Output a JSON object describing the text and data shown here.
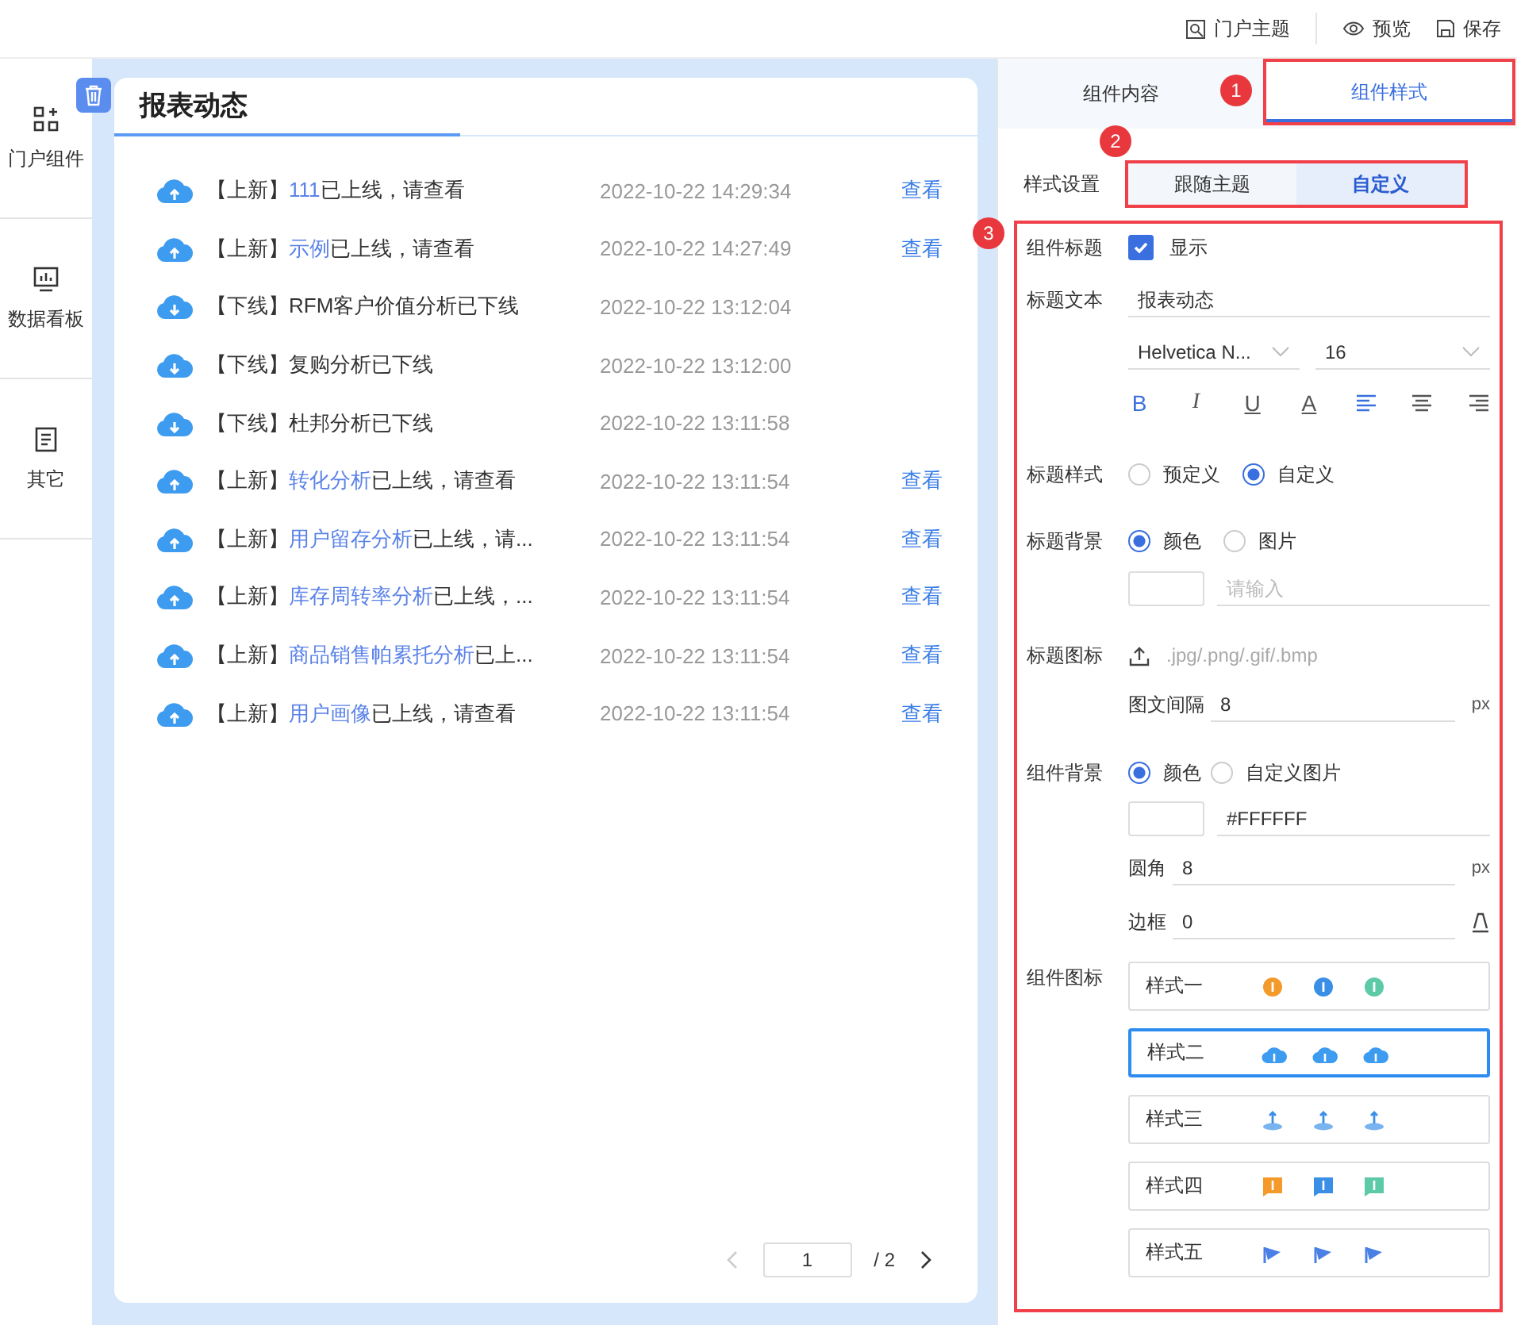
{
  "toolbar": [
    {
      "kind": "theme",
      "label": "门户主题"
    },
    {
      "kind": "preview",
      "label": "预览"
    },
    {
      "kind": "save",
      "label": "保存"
    }
  ],
  "sidebar": {
    "items": [
      {
        "kind": "components",
        "label": "门户组件"
      },
      {
        "kind": "dashboard",
        "label": "数据看板"
      },
      {
        "kind": "other",
        "label": "其它"
      }
    ]
  },
  "card": {
    "title": "报表动态",
    "rows": [
      {
        "kind": "up",
        "prefix": "【上新】",
        "link": "111",
        "suffix": "已上线，请查看",
        "time": "2022-10-22 14:29:34",
        "action": "查看"
      },
      {
        "kind": "up",
        "prefix": "【上新】",
        "link": "示例",
        "suffix": "已上线，请查看",
        "time": "2022-10-22 14:27:49",
        "action": "查看"
      },
      {
        "kind": "down",
        "prefix": "【下线】",
        "suffix": "RFM客户价值分析已下线",
        "time": "2022-10-22 13:12:04"
      },
      {
        "kind": "down",
        "prefix": "【下线】",
        "suffix": "复购分析已下线",
        "time": "2022-10-22 13:12:00"
      },
      {
        "kind": "down",
        "prefix": "【下线】",
        "suffix": "杜邦分析已下线",
        "time": "2022-10-22 13:11:58"
      },
      {
        "kind": "up",
        "prefix": "【上新】",
        "link": "转化分析",
        "suffix": "已上线，请查看",
        "time": "2022-10-22 13:11:54",
        "action": "查看"
      },
      {
        "kind": "up",
        "prefix": "【上新】",
        "link": "用户留存分析",
        "suffix": "已上线，请...",
        "time": "2022-10-22 13:11:54",
        "action": "查看"
      },
      {
        "kind": "up",
        "prefix": "【上新】",
        "link": "库存周转率分析",
        "suffix": "已上线，...",
        "time": "2022-10-22 13:11:54",
        "action": "查看"
      },
      {
        "kind": "up",
        "prefix": "【上新】",
        "link": "商品销售帕累托分析",
        "suffix": "已上...",
        "time": "2022-10-22 13:11:54",
        "action": "查看"
      },
      {
        "kind": "up",
        "prefix": "【上新】",
        "link": "用户画像",
        "suffix": "已上线，请查看",
        "time": "2022-10-22 13:11:54",
        "action": "查看"
      }
    ],
    "pagination": {
      "page": "1",
      "total": "/ 2"
    }
  },
  "panel": {
    "tabs": [
      {
        "label": "组件内容",
        "selected": false
      },
      {
        "label": "组件样式",
        "selected": true,
        "marker": "1"
      }
    ],
    "style_setting": {
      "label": "样式设置",
      "marker": "2",
      "options": [
        {
          "label": "跟随主题",
          "selected": false
        },
        {
          "label": "自定义",
          "selected": true
        }
      ]
    },
    "section_marker": "3",
    "title_show": {
      "label": "组件标题",
      "text": "显示",
      "checked": true
    },
    "title_text": {
      "label": "标题文本",
      "value": "报表动态",
      "font": "Helvetica N...",
      "size": "16",
      "format": [
        {
          "kind": "bold",
          "glyph": "B",
          "active": true
        },
        {
          "kind": "italic",
          "glyph": "I",
          "active": false
        },
        {
          "kind": "underline",
          "glyph": "U",
          "active": false
        },
        {
          "kind": "color",
          "glyph": "A",
          "active": false
        },
        {
          "kind": "align-left",
          "active": true
        },
        {
          "kind": "align-center",
          "active": false
        },
        {
          "kind": "align-right",
          "active": false
        }
      ]
    },
    "title_style": {
      "label": "标题样式",
      "options": [
        {
          "label": "预定义",
          "selected": false
        },
        {
          "label": "自定义",
          "selected": true
        }
      ]
    },
    "title_bg": {
      "label": "标题背景",
      "options": [
        {
          "label": "颜色",
          "selected": true
        },
        {
          "label": "图片",
          "selected": false
        }
      ],
      "placeholder": "请输入"
    },
    "title_icon": {
      "label": "标题图标",
      "hint": ".jpg/.png/.gif/.bmp",
      "gap_label": "图文间隔",
      "gap": "8",
      "unit": "px"
    },
    "comp_bg": {
      "label": "组件背景",
      "options": [
        {
          "label": "颜色",
          "selected": true
        },
        {
          "label": "自定义图片",
          "selected": false
        }
      ],
      "color": "#FFFFFF",
      "radius_label": "圆角",
      "radius": "8",
      "unit": "px",
      "border_label": "边框",
      "border": "0"
    },
    "comp_icon": {
      "label": "组件图标",
      "styles": [
        {
          "kind": "circle",
          "label": "样式一",
          "selected": false
        },
        {
          "kind": "cloud",
          "label": "样式二",
          "selected": true
        },
        {
          "kind": "drop",
          "label": "样式三",
          "selected": false
        },
        {
          "kind": "bubble",
          "label": "样式四",
          "selected": false
        },
        {
          "kind": "flag",
          "label": "样式五",
          "selected": false
        }
      ]
    }
  }
}
